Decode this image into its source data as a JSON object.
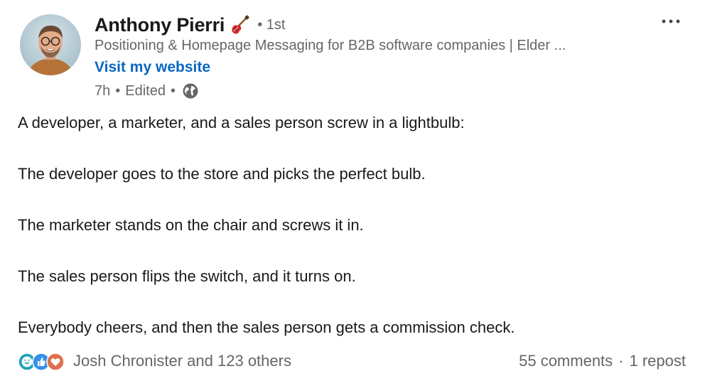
{
  "author": {
    "name": "Anthony Pierri",
    "name_emoji": "guitar-icon",
    "degree": "• 1st",
    "headline": "Positioning & Homepage Messaging for B2B software companies | Elder ...",
    "website_label": "Visit my website"
  },
  "meta": {
    "time": "7h",
    "separator": "•",
    "edited": "Edited",
    "visibility_icon": "globe-icon"
  },
  "post_lines": [
    "A developer, a marketer, and a sales person screw in a lightbulb:",
    "The developer goes to the store and picks the perfect bulb.",
    "The marketer stands on the chair and screws it in.",
    "The sales person flips the switch, and it turns on.",
    "Everybody cheers, and then the sales person gets a commission check."
  ],
  "social": {
    "reaction_icons": [
      "funny-icon",
      "like-icon",
      "love-icon"
    ],
    "reactors": "Josh Chronister and 123 others",
    "comments": "55 comments",
    "dot": "·",
    "reposts": "1 repost"
  },
  "colors": {
    "link": "#0a66c2",
    "secondary_text": "#666666",
    "primary_text": "#191919"
  }
}
